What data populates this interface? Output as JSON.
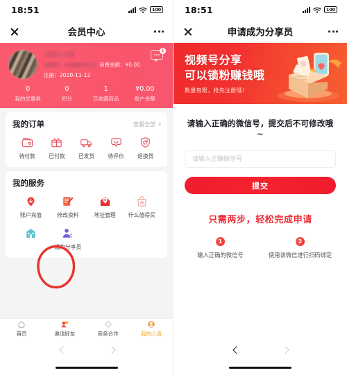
{
  "status_bar": {
    "time": "18:51",
    "battery": "100",
    "signal_icon": "signal-bars-icon",
    "wifi_icon": "wifi-icon"
  },
  "left_phone": {
    "nav": {
      "close_icon": "close-icon",
      "title": "会员中心",
      "more_icon": "more-dots-icon"
    },
    "profile": {
      "avatar_icon": "avatar",
      "message_icon": "message-bubble-icon",
      "message_badge": "1",
      "spend_label": "消费金额：",
      "spend_value": "¥0.00",
      "register_label": "注册：",
      "register_date": "2020-11-12",
      "stats": [
        {
          "value": "0",
          "label": "我的优惠券"
        },
        {
          "value": "0",
          "label": "积分"
        },
        {
          "value": "1",
          "label": "已收藏商品"
        },
        {
          "value": "¥0.00",
          "label": "账户余额"
        }
      ]
    },
    "orders": {
      "title": "我的订单",
      "more": "查看全部",
      "items": [
        {
          "label": "待付款",
          "icon": "wallet-icon"
        },
        {
          "label": "已付款",
          "icon": "box-icon"
        },
        {
          "label": "已发货",
          "icon": "truck-icon"
        },
        {
          "label": "待评价",
          "icon": "comment-icon"
        },
        {
          "label": "退换货",
          "icon": "return-shield-icon"
        }
      ]
    },
    "services": {
      "title": "我的服务",
      "row1": [
        {
          "label": "账户充值",
          "icon": "recharge-icon"
        },
        {
          "label": "修改资料",
          "icon": "edit-profile-icon"
        },
        {
          "label": "地址管理",
          "icon": "location-pin-icon"
        },
        {
          "label": "什么值得买",
          "icon": "shopping-bag-icon"
        }
      ],
      "row2": [
        {
          "label": "",
          "icon": "store-house-icon"
        },
        {
          "label": "成为分享员",
          "icon": "become-sharer-icon"
        }
      ]
    },
    "annotation": {
      "shape": "red-ellipse-highlight",
      "color": "#e8332e"
    },
    "tabbar": [
      {
        "label": "首页",
        "icon": "home-icon",
        "active": false
      },
      {
        "label": "邀请好友",
        "icon": "invite-friends-icon",
        "active": false
      },
      {
        "label": "商务合作",
        "icon": "business-cooperation-icon",
        "active": false
      },
      {
        "label": "我的心语",
        "icon": "profile-icon",
        "active": true
      }
    ],
    "page_nav": {
      "back_icon": "chevron-left-icon",
      "forward_icon": "chevron-right-icon"
    }
  },
  "right_phone": {
    "nav": {
      "close_icon": "close-icon",
      "title": "申请成为分享员",
      "more_icon": "more-dots-icon"
    },
    "banner": {
      "line1": "视频号分享",
      "line2": "可以锁粉赚钱哦",
      "subtitle": "数量有限，抢先注册哦！",
      "art_icon": "gift-box-phone-illustration"
    },
    "form": {
      "heading": "请输入正确的微信号，提交后不可修改哦~",
      "input_value": "",
      "input_placeholder": "请输入正确微信号",
      "submit_label": "提交"
    },
    "steps": {
      "title": "只需两步，轻松完成申请",
      "items": [
        {
          "num": "1",
          "text": "输入正确的微信号"
        },
        {
          "num": "2",
          "text": "使用该微信进行扫码绑定"
        }
      ]
    },
    "page_nav": {
      "back_icon": "chevron-left-icon",
      "forward_icon": "chevron-right-icon"
    }
  },
  "colors": {
    "profile_gradient_start": "#fb5a6e",
    "banner_red": "#f02a2a",
    "accent_red": "#ef2b34",
    "tab_active": "#f6a623"
  }
}
